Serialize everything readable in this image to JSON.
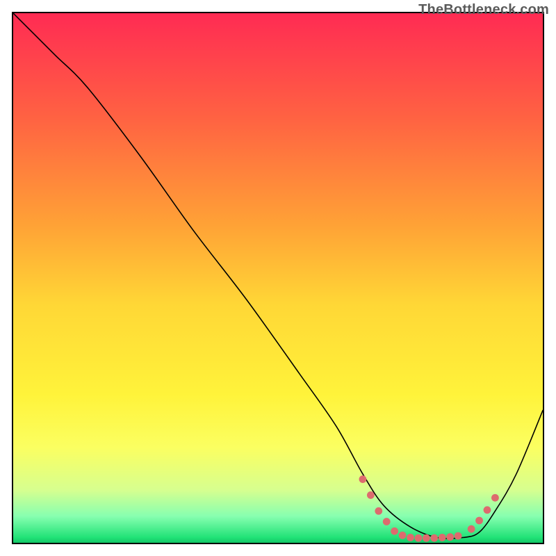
{
  "watermark": "TheBottleneck.com",
  "chart_data": {
    "type": "line",
    "title": "",
    "xlabel": "",
    "ylabel": "",
    "xlim": [
      0,
      100
    ],
    "ylim": [
      0,
      100
    ],
    "grid": false,
    "legend": false,
    "background_gradient": {
      "stops": [
        {
          "offset": 0,
          "color": "#ff2b53"
        },
        {
          "offset": 20,
          "color": "#ff6342"
        },
        {
          "offset": 40,
          "color": "#ffa236"
        },
        {
          "offset": 55,
          "color": "#ffd736"
        },
        {
          "offset": 72,
          "color": "#fff33a"
        },
        {
          "offset": 82,
          "color": "#fbff61"
        },
        {
          "offset": 90,
          "color": "#d7ff8f"
        },
        {
          "offset": 95,
          "color": "#87ffb0"
        },
        {
          "offset": 99,
          "color": "#21e277"
        },
        {
          "offset": 100,
          "color": "#12c766"
        }
      ]
    },
    "series": [
      {
        "name": "curve",
        "x": [
          0,
          4,
          8,
          14,
          24,
          34,
          44,
          54,
          61,
          66,
          70,
          75,
          80,
          85,
          88,
          91,
          95,
          100
        ],
        "y": [
          100,
          96,
          92,
          86,
          73,
          59,
          46,
          32,
          22,
          13,
          7,
          3,
          1,
          1,
          2,
          6,
          13,
          25
        ]
      }
    ],
    "markers": {
      "name": "highlight-dots",
      "color": "#dd6b6e",
      "points": [
        {
          "x": 66.0,
          "y": 12.0
        },
        {
          "x": 67.5,
          "y": 9.0
        },
        {
          "x": 69.0,
          "y": 6.0
        },
        {
          "x": 70.5,
          "y": 4.0
        },
        {
          "x": 72.0,
          "y": 2.2
        },
        {
          "x": 73.5,
          "y": 1.4
        },
        {
          "x": 75.0,
          "y": 1.0
        },
        {
          "x": 76.5,
          "y": 0.9
        },
        {
          "x": 78.0,
          "y": 0.9
        },
        {
          "x": 79.5,
          "y": 0.9
        },
        {
          "x": 81.0,
          "y": 1.0
        },
        {
          "x": 82.5,
          "y": 1.1
        },
        {
          "x": 84.0,
          "y": 1.3
        },
        {
          "x": 86.5,
          "y": 2.6
        },
        {
          "x": 88.0,
          "y": 4.2
        },
        {
          "x": 89.5,
          "y": 6.2
        },
        {
          "x": 91.0,
          "y": 8.5
        }
      ]
    }
  }
}
